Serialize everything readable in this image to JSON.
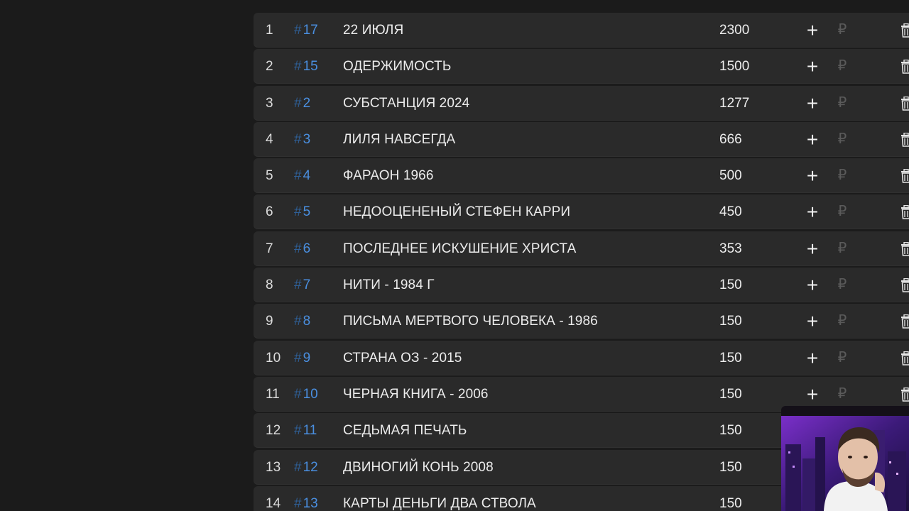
{
  "rows": [
    {
      "position": "1",
      "tag": "17",
      "title": "22 ИЮЛЯ",
      "amount": "2300"
    },
    {
      "position": "2",
      "tag": "15",
      "title": "ОДЕРЖИМОСТЬ",
      "amount": "1500"
    },
    {
      "position": "3",
      "tag": "2",
      "title": "СУБСТАНЦИЯ 2024",
      "amount": "1277"
    },
    {
      "position": "4",
      "tag": "3",
      "title": "ЛИЛЯ НАВСЕГДА",
      "amount": "666"
    },
    {
      "position": "5",
      "tag": "4",
      "title": "ФАРАОН 1966",
      "amount": "500"
    },
    {
      "position": "6",
      "tag": "5",
      "title": "НЕДООЦЕНЕНЫЙ СТЕФЕН КАРРИ",
      "amount": "450"
    },
    {
      "position": "7",
      "tag": "6",
      "title": "ПОСЛЕДНЕЕ ИСКУШЕНИЕ ХРИСТА",
      "amount": "353"
    },
    {
      "position": "8",
      "tag": "7",
      "title": "НИТИ - 1984 Г",
      "amount": "150"
    },
    {
      "position": "9",
      "tag": "8",
      "title": "ПИСЬМА МЕРТВОГО ЧЕЛОВЕКА - 1986",
      "amount": "150"
    },
    {
      "position": "10",
      "tag": "9",
      "title": "СТРАНА ОЗ - 2015",
      "amount": "150"
    },
    {
      "position": "11",
      "tag": "10",
      "title": "ЧЕРНАЯ КНИГА - 2006",
      "amount": "150"
    },
    {
      "position": "12",
      "tag": "11",
      "title": "СЕДЬМАЯ ПЕЧАТЬ",
      "amount": "150"
    },
    {
      "position": "13",
      "tag": "12",
      "title": "ДВИНОГИЙ КОНЬ 2008",
      "amount": "150"
    },
    {
      "position": "14",
      "tag": "13",
      "title": "КАРТЫ ДЕНЬГИ ДВА СТВОЛА",
      "amount": "150"
    }
  ],
  "symbols": {
    "hash": "#",
    "plus": "+",
    "ruble": "₽"
  },
  "colors": {
    "background": "#1b1b1b",
    "row_background": "#2a2a2a",
    "tag_accent": "#4a8fe0",
    "text": "#ececec",
    "ruble_muted": "#5a5a5a"
  },
  "icons": {
    "add": "plus-icon",
    "currency": "ruble-icon",
    "delete": "trash-icon"
  }
}
